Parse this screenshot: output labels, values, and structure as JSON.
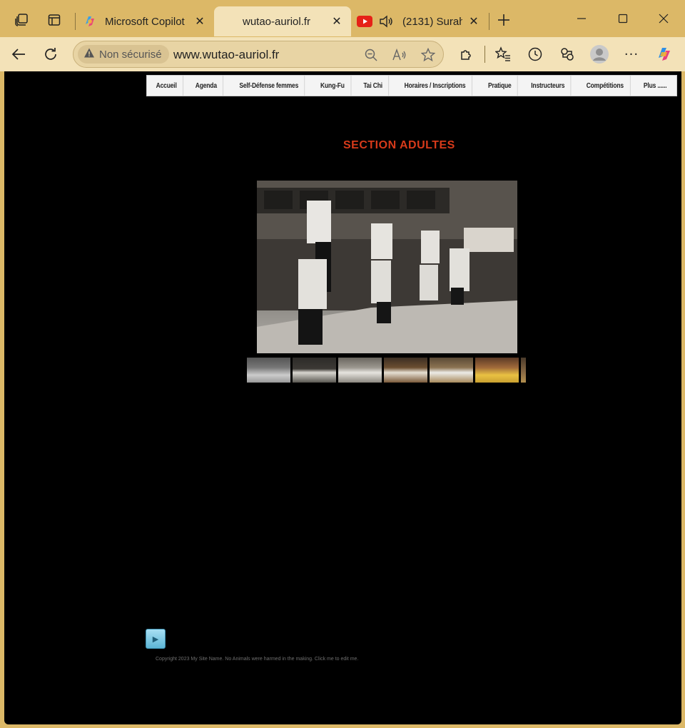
{
  "browser": {
    "tabs": [
      {
        "title": "Microsoft Copilot",
        "icon": "copilot-icon",
        "active": false
      },
      {
        "title": "wutao-auriol.fr",
        "icon": "",
        "active": true
      },
      {
        "title": "(2131) Surah",
        "icon": "youtube-icon",
        "active": false
      }
    ],
    "security_label": "Non sécurisé",
    "url": "www.wutao-auriol.fr"
  },
  "page": {
    "nav": [
      "Accueil",
      "Agenda",
      "Self-Défense femmes",
      "Kung-Fu",
      "Tai Chi",
      "Horaires / Inscriptions",
      "Pratique",
      "Instructeurs",
      "Compétitions",
      "Plus ......"
    ],
    "section_title": "SECTION ADULTES",
    "thumbnails_count": 7,
    "copyright": "Copyright 2023 My Site Name. No Animals were harmed in the making. Click me to edit me."
  },
  "colors": {
    "frame": "#dcb867",
    "toolbar": "#f3e2b8",
    "page_background": "#000000",
    "title_red": "#d63a1a"
  }
}
